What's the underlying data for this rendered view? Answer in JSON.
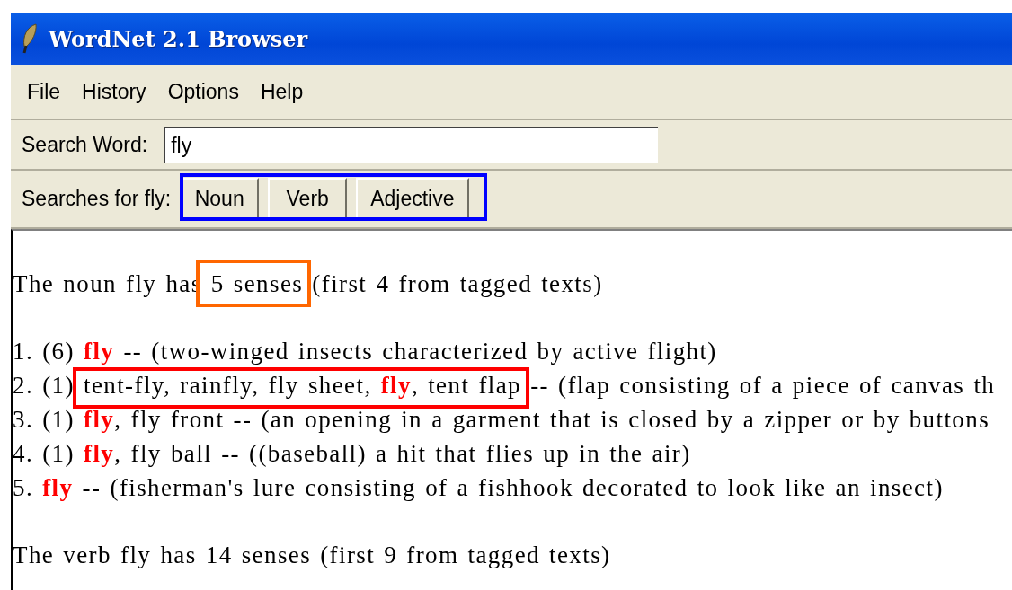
{
  "window": {
    "title": "WordNet 2.1 Browser"
  },
  "menu": [
    {
      "label": "File"
    },
    {
      "label": "History"
    },
    {
      "label": "Options"
    },
    {
      "label": "Help"
    }
  ],
  "search": {
    "label": "Search Word:",
    "value": "fly"
  },
  "searches": {
    "label": "Searches for fly:",
    "buttons": [
      {
        "label": "Noun"
      },
      {
        "label": "Verb"
      },
      {
        "label": "Adjective"
      }
    ]
  },
  "results": [
    {
      "kind": "heading",
      "text": "The noun fly has 5 senses (first 4 from tagged texts)"
    },
    {
      "kind": "sense",
      "text": "1. (6) **fly** -- (two-winged insects characterized by active flight)"
    },
    {
      "kind": "sense",
      "text": "2. (1) tent-fly, rainfly, fly sheet, **fly**, tent flap -- (flap consisting of a piece of canvas th"
    },
    {
      "kind": "sense",
      "text": "3. (1) **fly**, fly front -- (an opening in a garment that is closed by a zipper or by buttons"
    },
    {
      "kind": "sense",
      "text": "4. (1) **fly**, fly ball -- ((baseball) a hit that flies up in the air)"
    },
    {
      "kind": "sense",
      "text": "5. **fly** -- (fisherman's lure consisting of a fishhook decorated to look like an insect)"
    },
    {
      "kind": "heading",
      "text": "The verb fly has 14 senses (first 9 from tagged texts)"
    }
  ],
  "annotations": [
    {
      "color": "#0000ff"
    },
    {
      "color": "#ff6600"
    },
    {
      "color": "#ff0000"
    }
  ]
}
